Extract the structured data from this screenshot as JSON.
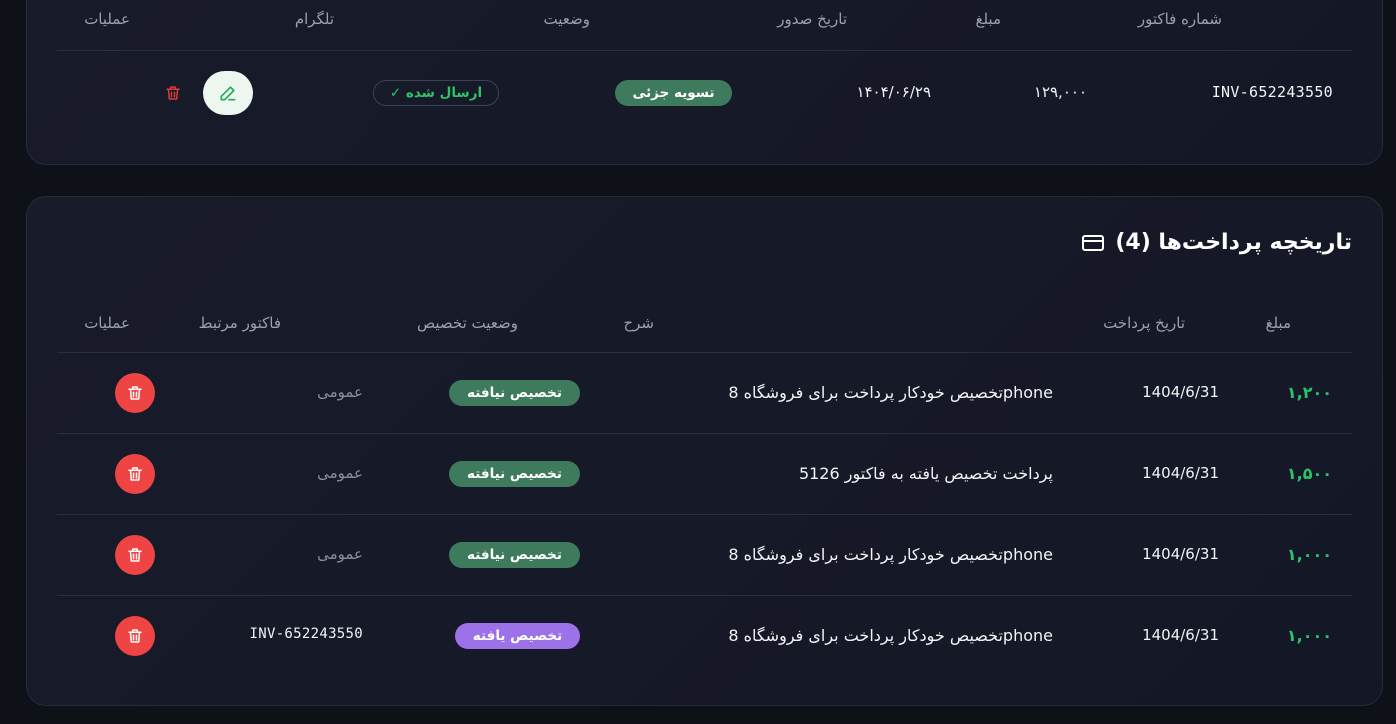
{
  "invoices": {
    "headers": {
      "invoice_number": "شماره فاکتور",
      "amount": "مبلغ",
      "issue_date": "تاریخ صدور",
      "status": "وضعیت",
      "telegram": "تلگرام",
      "actions": "عملیات"
    },
    "row": {
      "invoice_number": "INV-652243550",
      "amount": "۱۲۹,۰۰۰",
      "issue_date": "۱۴۰۴/۰۶/۲۹",
      "status": "تسویه جزئی",
      "telegram": "✓ ارسال شده"
    }
  },
  "payments": {
    "title": "تاریخچه پرداخت‌ها (4)",
    "headers": {
      "amount": "مبلغ",
      "payment_date": "تاریخ پرداخت",
      "description": "شرح",
      "allocation_status": "وضعیت تخصیص",
      "related_invoice": "فاکتور مرتبط",
      "actions": "عملیات"
    },
    "rows": [
      {
        "amount": "۱,۲۰۰",
        "date": "1404/6/31",
        "description": "تخصیص خودکار پرداخت برای فروشگاه 8phone",
        "allocation": "تخصیص نیافته",
        "allocation_state": "unallocated",
        "related": "عمومی"
      },
      {
        "amount": "۱,۵۰۰",
        "date": "1404/6/31",
        "description": "پرداخت تخصیص یافته به فاکتور 5126",
        "allocation": "تخصیص نیافته",
        "allocation_state": "unallocated",
        "related": "عمومی"
      },
      {
        "amount": "۱,۰۰۰",
        "date": "1404/6/31",
        "description": "تخصیص خودکار پرداخت برای فروشگاه 8phone",
        "allocation": "تخصیص نیافته",
        "allocation_state": "unallocated",
        "related": "عمومی"
      },
      {
        "amount": "۱,۰۰۰",
        "date": "1404/6/31",
        "description": "تخصیص خودکار پرداخت برای فروشگاه 8phone",
        "allocation": "تخصیص یافته",
        "allocation_state": "allocated",
        "related": "INV-652243550"
      }
    ]
  },
  "colors": {
    "background": "#0f1119",
    "card": "#181b2a",
    "success_green": "#2dc36a",
    "badge_green": "#3e7a5c",
    "badge_purple": "#9d72e8",
    "danger_red": "#ef4444"
  },
  "icons": {
    "edit": "pencil-icon",
    "delete": "trash-icon",
    "payment_history": "credit-card-icon"
  }
}
